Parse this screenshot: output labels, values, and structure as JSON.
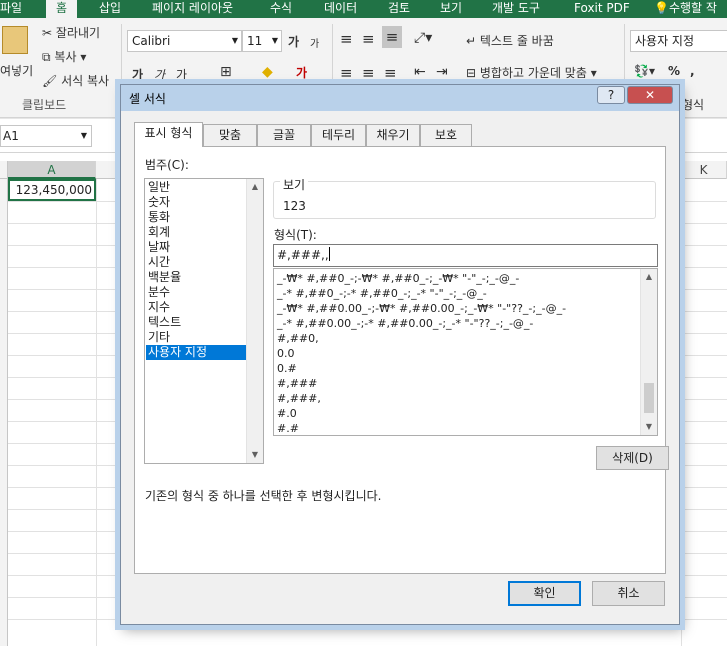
{
  "ribbon": {
    "tabs": [
      "파일",
      "홈",
      "삽입",
      "페이지 레이아웃",
      "수식",
      "데이터",
      "검토",
      "보기",
      "개발 도구",
      "Foxit PDF",
      "수행할 작"
    ],
    "active_tab": "홈",
    "clipboard": {
      "paste": "여넣기",
      "cut": "잘라내기",
      "copy": "복사",
      "format_painter": "서식 복사",
      "group_label": "클립보드"
    },
    "font": {
      "name": "Calibri",
      "size": "11",
      "grow": "가",
      "shrink": "가",
      "bold": "가",
      "italic": "가",
      "underline": "가"
    },
    "alignment": {
      "wrap_text": "텍스트 줄 바꿈",
      "merge_center": "병합하고 가운데 맞춤"
    },
    "number": {
      "format": "사용자 지정",
      "percent": "%",
      "comma": ","
    },
    "styles_group": "형식"
  },
  "sheet": {
    "name_box": "A1",
    "columns": [
      "A",
      "K"
    ],
    "cell_a1": "123,450,000"
  },
  "dialog": {
    "title": "셀 서식",
    "help": "?",
    "close": "✕",
    "tabs": [
      "표시 형식",
      "맞춤",
      "글꼴",
      "테두리",
      "채우기",
      "보호"
    ],
    "active_tab": "표시 형식",
    "category_label": "범주(C):",
    "categories": [
      "일반",
      "숫자",
      "통화",
      "회계",
      "날짜",
      "시간",
      "백분율",
      "분수",
      "지수",
      "텍스트",
      "기타",
      "사용자 지정"
    ],
    "selected_category": "사용자 지정",
    "sample_label": "보기",
    "sample_value": "123",
    "type_label": "형식(T):",
    "type_value": "#,###,,",
    "formats": [
      "_-₩* #,##0_-;-₩* #,##0_-;_-₩* \"-\"_-;_-@_-",
      "_-* #,##0_-;-* #,##0_-;_-* \"-\"_-;_-@_-",
      "_-₩* #,##0.00_-;-₩* #,##0.00_-;_-₩* \"-\"??_-;_-@_-",
      "_-* #,##0.00_-;-* #,##0.00_-;_-* \"-\"??_-;_-@_-",
      "#,##0,",
      "0.0",
      "0.#",
      "#,###",
      "#,###,",
      "#.0",
      "#.#"
    ],
    "delete_button": "삭제(D)",
    "hint": "기존의 형식 중 하나를 선택한 후 변형시킵니다.",
    "ok_button": "확인",
    "cancel_button": "취소"
  },
  "colors": {
    "excel_green": "#217346",
    "selection_blue": "#0078d7",
    "title_bar": "#b9d1ea"
  }
}
